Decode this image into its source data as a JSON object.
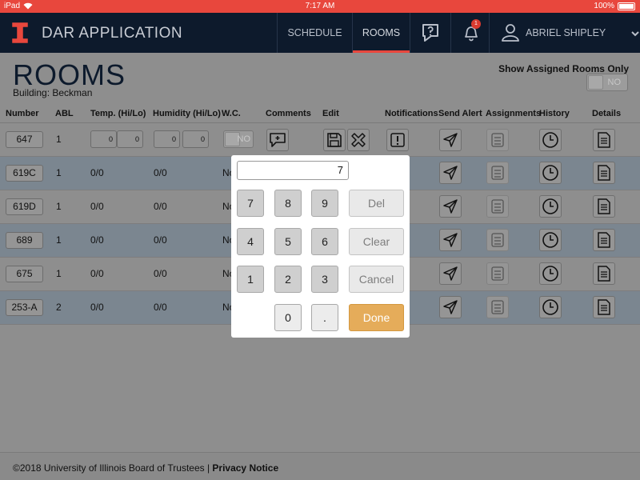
{
  "status_bar": {
    "carrier": "iPad",
    "time": "7:17 AM",
    "battery": "100%"
  },
  "header": {
    "app_title": "DAR APPLICATION",
    "nav": {
      "schedule": "SCHEDULE",
      "rooms": "ROOMS"
    },
    "notification_count": "1",
    "user_name": "ABRIEL SHIPLEY"
  },
  "page": {
    "title": "ROOMS",
    "building": "Building: Beckman",
    "assigned_label": "Show Assigned Rooms Only",
    "assigned_toggle": "NO"
  },
  "table": {
    "headers": {
      "number": "Number",
      "abl": "ABL",
      "temp": "Temp. (Hi/Lo)",
      "humidity": "Humidity (Hi/Lo)",
      "wc": "W.C.",
      "comments": "Comments",
      "edit": "Edit",
      "notifications": "Notifications",
      "send_alert": "Send Alert",
      "assignments": "Assignments",
      "history": "History",
      "details": "Details"
    },
    "edit_row": {
      "number": "647",
      "abl": "1",
      "temp_hi": "0",
      "temp_lo": "0",
      "hum_hi": "0",
      "hum_lo": "0",
      "wc": "NO"
    },
    "rows": [
      {
        "number": "619C",
        "abl": "1",
        "temp": "0/0",
        "humidity": "0/0",
        "wc": "No"
      },
      {
        "number": "619D",
        "abl": "1",
        "temp": "0/0",
        "humidity": "0/0",
        "wc": "No"
      },
      {
        "number": "689",
        "abl": "1",
        "temp": "0/0",
        "humidity": "0/0",
        "wc": "No"
      },
      {
        "number": "675",
        "abl": "1",
        "temp": "0/0",
        "humidity": "0/0",
        "wc": "No"
      },
      {
        "number": "253-A",
        "abl": "2",
        "temp": "0/0",
        "humidity": "0/0",
        "wc": "No"
      }
    ]
  },
  "keypad": {
    "value": "7",
    "digits": {
      "d0": "0",
      "d1": "1",
      "d2": "2",
      "d3": "3",
      "d4": "4",
      "d5": "5",
      "d6": "6",
      "d7": "7",
      "d8": "8",
      "d9": "9",
      "dot": "."
    },
    "del": "Del",
    "clear": "Clear",
    "cancel": "Cancel",
    "done": "Done"
  },
  "footer": {
    "copyright": "©2018 University of Illinois Board of Trustees | ",
    "privacy": "Privacy Notice"
  },
  "colors": {
    "nav_bg": "#0d1a2c",
    "accent": "#e8473d",
    "done": "#e5ac5a",
    "overlay": "#8e8e8e"
  }
}
